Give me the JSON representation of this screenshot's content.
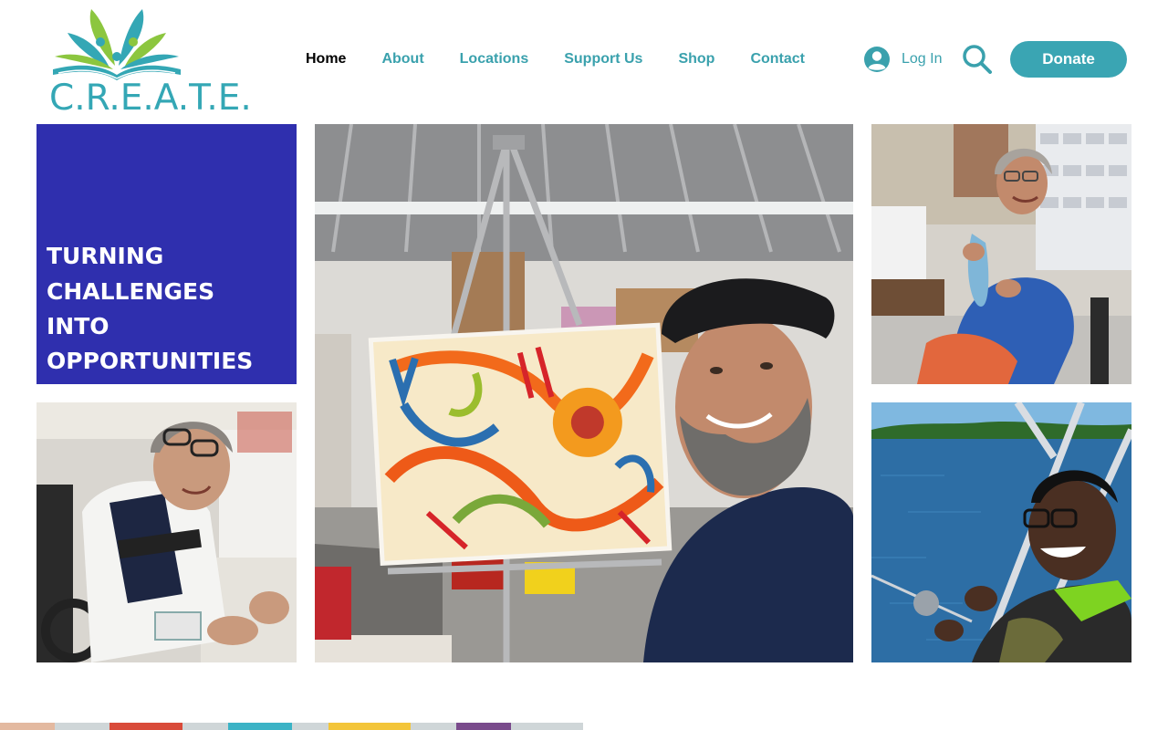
{
  "header": {
    "logo_text": "C.R.E.A.T.E.",
    "nav": [
      {
        "label": "Home",
        "active": true
      },
      {
        "label": "About",
        "active": false
      },
      {
        "label": "Locations",
        "active": false
      },
      {
        "label": "Support Us",
        "active": false
      },
      {
        "label": "Shop",
        "active": false
      },
      {
        "label": "Contact",
        "active": false
      }
    ],
    "login_label": "Log In",
    "donate_label": "Donate"
  },
  "gallery": {
    "tagline_lines": [
      "TURNING",
      "CHALLENGES",
      "INTO",
      "OPPORTUNITIES"
    ]
  },
  "colors": {
    "accent": "#3aa5b3",
    "tagline_bg": "#2f2fae",
    "logo_green": "#8cc63f",
    "logo_teal": "#34a7b5"
  },
  "icons": [
    "user-avatar-icon",
    "search-icon"
  ]
}
